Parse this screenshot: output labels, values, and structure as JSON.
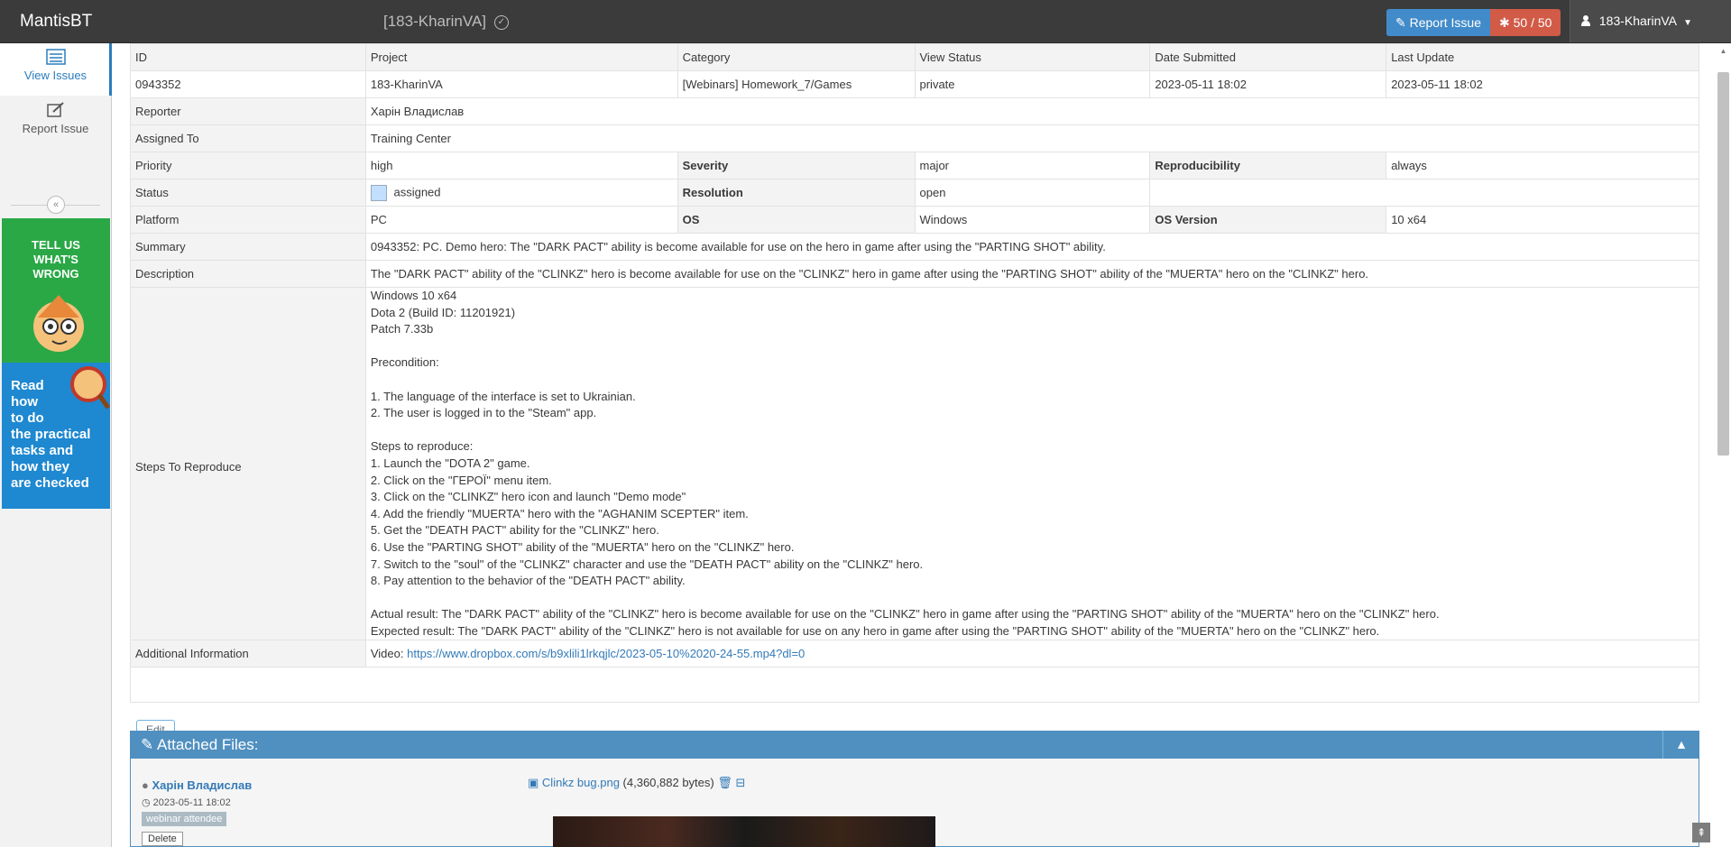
{
  "navbar": {
    "brand": "MantisBT",
    "project": "[183-KharinVA]",
    "report_issue": "Report Issue",
    "count": "50 / 50",
    "user": "183-KharinVA"
  },
  "sidebar": {
    "items": [
      {
        "label": "View Issues"
      },
      {
        "label": "Report Issue"
      }
    ],
    "ad_green": "TELL US\nWHAT'S\nWRONG",
    "ad_blue": "Read\nhow\nto do\nthe practical\ntasks and\nhow they\nare checked"
  },
  "issue": {
    "headers": [
      "ID",
      "Project",
      "Category",
      "View Status",
      "Date Submitted",
      "Last Update"
    ],
    "values": [
      "0943352",
      "183-KharinVA",
      "[Webinars] Homework_7/Games",
      "private",
      "2023-05-11 18:02",
      "2023-05-11 18:02"
    ],
    "reporter_label": "Reporter",
    "reporter": "Харін Владислав",
    "assigned_label": "Assigned To",
    "assigned": "Training Center",
    "priority_label": "Priority",
    "priority": "high",
    "severity_label": "Severity",
    "severity": "major",
    "reproducibility_label": "Reproducibility",
    "reproducibility": "always",
    "status_label": "Status",
    "status": "assigned",
    "resolution_label": "Resolution",
    "resolution": "open",
    "platform_label": "Platform",
    "platform": "PC",
    "os_label": "OS",
    "os": "Windows",
    "os_version_label": "OS Version",
    "os_version": "10 x64",
    "summary_label": "Summary",
    "summary": "0943352: PC. Demo hero: The \"DARK PACT\" ability is become available for use on the hero in game after using the \"PARTING SHOT\" ability.",
    "description_label": "Description",
    "description": "The \"DARK PACT\" ability of the \"CLINKZ\" hero is become available for use on the \"CLINKZ\" hero in game after using the \"PARTING SHOT\" ability of the \"MUERTA\" hero on the \"CLINKZ\" hero.",
    "steps_label": "Steps To Reproduce",
    "steps": "Windows 10 x64\nDota 2 (Build ID: 11201921)\nPatch 7.33b\n\nPrecondition:\n\n1. The language of the interface is set to Ukrainian.\n2. The user is logged in to the \"Steam\" app.\n\nSteps to reproduce:\n1. Launch the \"DOTA 2\" game.\n2. Click on the \"ГЕРОЇ\" menu item.\n3. Click on the \"CLINKZ\" hero icon and launch \"Demo mode\"\n4. Add the friendly \"MUERTA\" hero with the \"AGHANIM SCEPTER\" item.\n5. Get the \"DEATH PACT\" ability for the \"CLINKZ\" hero.\n6. Use the \"PARTING SHOT\" ability of the \"MUERTA\" hero on the \"CLINKZ\" hero.\n7. Switch to the \"soul\" of the \"CLINKZ\" character and use the \"DEATH PACT\" ability on the \"CLINKZ\" hero.\n8. Pay attention to the behavior of the \"DEATH PACT\" ability.\n\nActual result: The \"DARK PACT\" ability of the \"CLINKZ\" hero is become available for use on the \"CLINKZ\" hero in game after using the \"PARTING SHOT\" ability of the \"MUERTA\" hero on the \"CLINKZ\" hero.\nExpected result: The \"DARK PACT\" ability of the \"CLINKZ\" hero is not available for use on any hero in game after using the \"PARTING SHOT\" ability of the \"MUERTA\" hero on the \"CLINKZ\" hero.",
    "additional_label": "Additional Information",
    "additional_prefix": "Video:",
    "additional_link": "https://www.dropbox.com/s/b9xlili1lrkqjlc/2023-05-10%2020-24-55.mp4?dl=0",
    "edit_button": "Edit"
  },
  "attachments": {
    "title": "Attached Files:",
    "uploader": "Харін Владислав",
    "date": "2023-05-11 18:02",
    "badge": "webinar attendee",
    "delete_button": "Delete",
    "file_name": "Clinkz bug.png",
    "file_size": "(4,360,882 bytes)"
  },
  "colors": {
    "navbar": "#3b3b3b",
    "accent": "#428bca",
    "danger": "#d15b47",
    "panel_header": "#5090c1"
  }
}
